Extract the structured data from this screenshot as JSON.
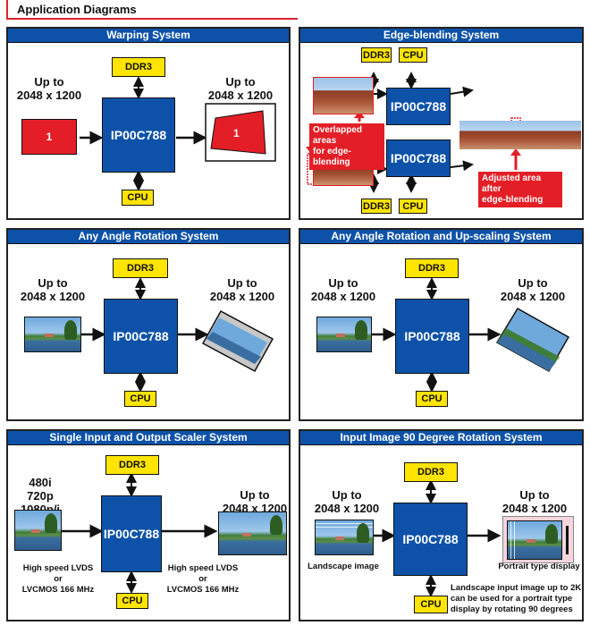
{
  "header": {
    "title": "Application Diagrams"
  },
  "colors": {
    "accent_red": "#d9232a",
    "chip_blue": "#0d52a8",
    "box_yellow": "#ffe400"
  },
  "panels": [
    {
      "title": "Warping System",
      "chip": "IP00C788",
      "top_box": "DDR3",
      "bottom_box": "CPU",
      "input_label": [
        "Up to",
        "2048 x 1200"
      ],
      "output_label": [
        "Up to",
        "2048 x 1200"
      ],
      "input_symbol": "1",
      "output_symbol": "1"
    },
    {
      "title": "Edge-blending System",
      "chip_top": "IP00C788",
      "chip_bottom": "IP00C788",
      "boxes_top": [
        "DDR3",
        "CPU"
      ],
      "boxes_bottom": [
        "DDR3",
        "CPU"
      ],
      "callout_overlap": [
        "Overlapped areas",
        "for edge-blending"
      ],
      "callout_adjusted": [
        "Adjusted area after",
        "edge-blending"
      ]
    },
    {
      "title": "Any Angle Rotation System",
      "chip": "IP00C788",
      "top_box": "DDR3",
      "bottom_box": "CPU",
      "input_label": [
        "Up to",
        "2048 x 1200"
      ],
      "output_label": [
        "Up to",
        "2048 x 1200"
      ]
    },
    {
      "title": "Any Angle Rotation and Up-scaling System",
      "chip": "IP00C788",
      "top_box": "DDR3",
      "bottom_box": "CPU",
      "input_label": [
        "Up to",
        "2048 x 1200"
      ],
      "output_label": [
        "Up to",
        "2048 x 1200"
      ]
    },
    {
      "title": "Single Input and Output Scaler System",
      "chip": "IP00C788",
      "top_box": "DDR3",
      "bottom_box": "CPU",
      "input_label": [
        "480i",
        "720p",
        "1080p/i"
      ],
      "output_label": [
        "Up to",
        "2048 x 1200"
      ],
      "input_interface": [
        "High speed LVDS",
        "or",
        "LVCMOS 166 MHz"
      ],
      "output_interface": [
        "High speed LVDS",
        "or",
        "LVCMOS 166 MHz"
      ]
    },
    {
      "title": "Input Image 90 Degree Rotation System",
      "chip": "IP00C788",
      "top_box": "DDR3",
      "bottom_box": "CPU",
      "input_label": [
        "Up to",
        "2048 x 1200"
      ],
      "output_label": [
        "Up to",
        "2048 x 1200"
      ],
      "input_caption": "Landscape image",
      "output_caption": "Portrait type display",
      "note": [
        "Landscape input image up to 2K",
        "can be used for a portrait type",
        "display by rotating 90 degrees"
      ]
    }
  ]
}
